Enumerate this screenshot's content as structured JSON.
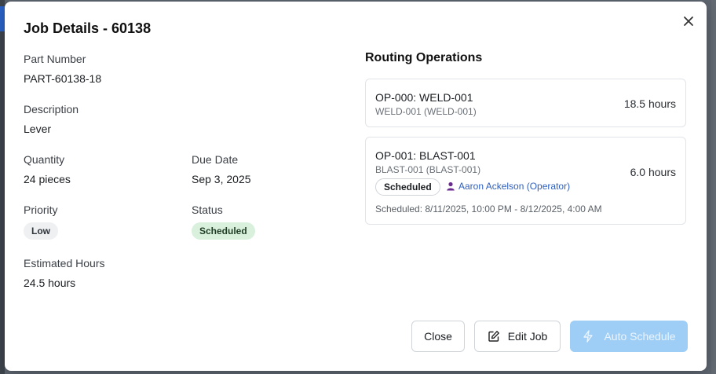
{
  "modal": {
    "title": "Job Details - 60138"
  },
  "fields": {
    "part_number": {
      "label": "Part Number",
      "value": "PART-60138-18"
    },
    "description": {
      "label": "Description",
      "value": "Lever"
    },
    "quantity": {
      "label": "Quantity",
      "value": "24 pieces"
    },
    "due_date": {
      "label": "Due Date",
      "value": "Sep 3, 2025"
    },
    "priority": {
      "label": "Priority",
      "value": "Low"
    },
    "status": {
      "label": "Status",
      "value": "Scheduled"
    },
    "estimated_hours": {
      "label": "Estimated Hours",
      "value": "24.5 hours"
    }
  },
  "routing": {
    "title": "Routing Operations",
    "operations": [
      {
        "title": "OP-000: WELD-001",
        "subtitle": "WELD-001 (WELD-001)",
        "hours": "18.5 hours"
      },
      {
        "title": "OP-001: BLAST-001",
        "subtitle": "BLAST-001 (BLAST-001)",
        "hours": "6.0 hours",
        "status": "Scheduled",
        "operator": "Aaron Ackelson (Operator)",
        "scheduled": "Scheduled: 8/11/2025, 10:00 PM - 8/12/2025, 4:00 AM"
      }
    ]
  },
  "buttons": {
    "close": "Close",
    "edit": "Edit Job",
    "auto_schedule": "Auto Schedule"
  },
  "colors": {
    "status_badge_bg": "#d8f0dc",
    "priority_badge_bg": "#eef0f2",
    "operator_link": "#2f5fbf",
    "auto_schedule_disabled": "#9ecdf5"
  },
  "icons": [
    "close-icon",
    "user-icon",
    "edit-icon",
    "lightning-icon"
  ]
}
